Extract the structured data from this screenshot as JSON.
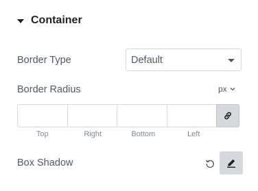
{
  "section": {
    "title": "Container"
  },
  "border_type": {
    "label": "Border Type",
    "value": "Default"
  },
  "border_radius": {
    "label": "Border Radius",
    "unit": "px",
    "fields": [
      {
        "label": "Top",
        "value": ""
      },
      {
        "label": "Right",
        "value": ""
      },
      {
        "label": "Bottom",
        "value": ""
      },
      {
        "label": "Left",
        "value": ""
      }
    ]
  },
  "box_shadow": {
    "label": "Box Shadow"
  },
  "icons": {
    "section_toggle": "caret-down-icon",
    "select_arrow": "chevron-down-icon",
    "unit_arrow": "chevron-down-icon",
    "link": "link-icon",
    "reset": "reset-icon",
    "edit": "pencil-icon"
  },
  "colors": {
    "heading": "#1f2124",
    "text": "#515962",
    "muted": "#818a96",
    "border": "#d5d8dc",
    "button_bg": "#d5d8dc"
  }
}
